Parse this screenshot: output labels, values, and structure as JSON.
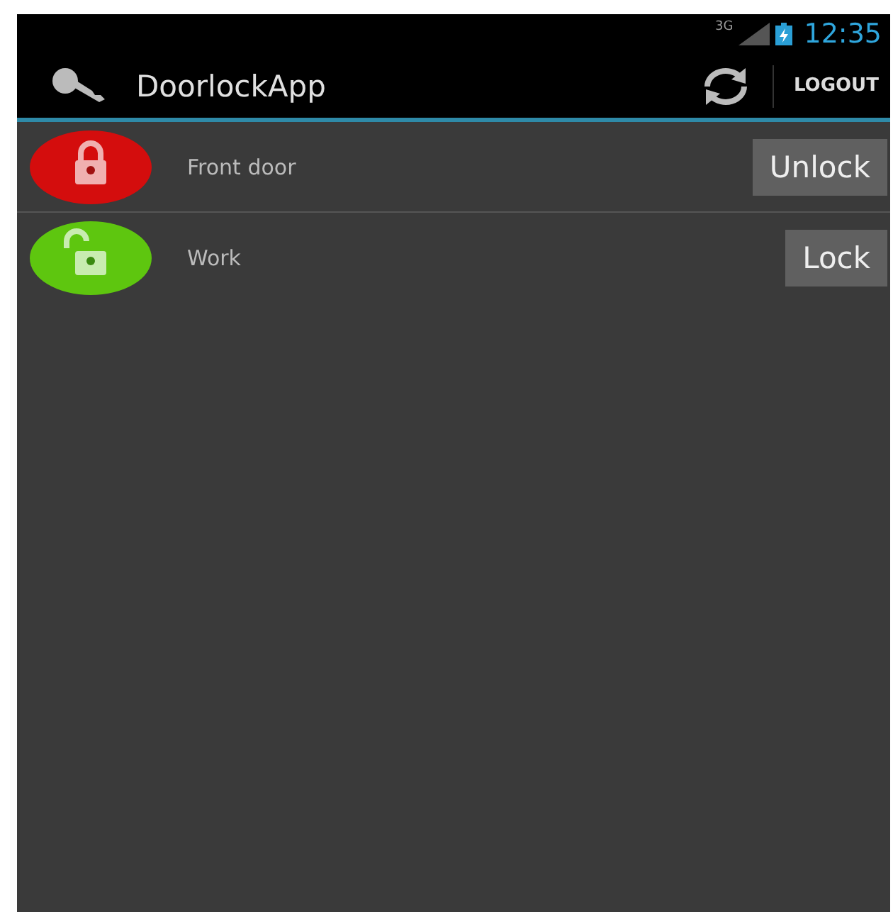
{
  "status_bar": {
    "network": "3G",
    "time": "12:35"
  },
  "action_bar": {
    "title": "DoorlockApp",
    "logout": "LOGOUT"
  },
  "doors": [
    {
      "name": "Front door",
      "locked": true,
      "action": "Unlock"
    },
    {
      "name": "Work",
      "locked": false,
      "action": "Lock"
    }
  ]
}
